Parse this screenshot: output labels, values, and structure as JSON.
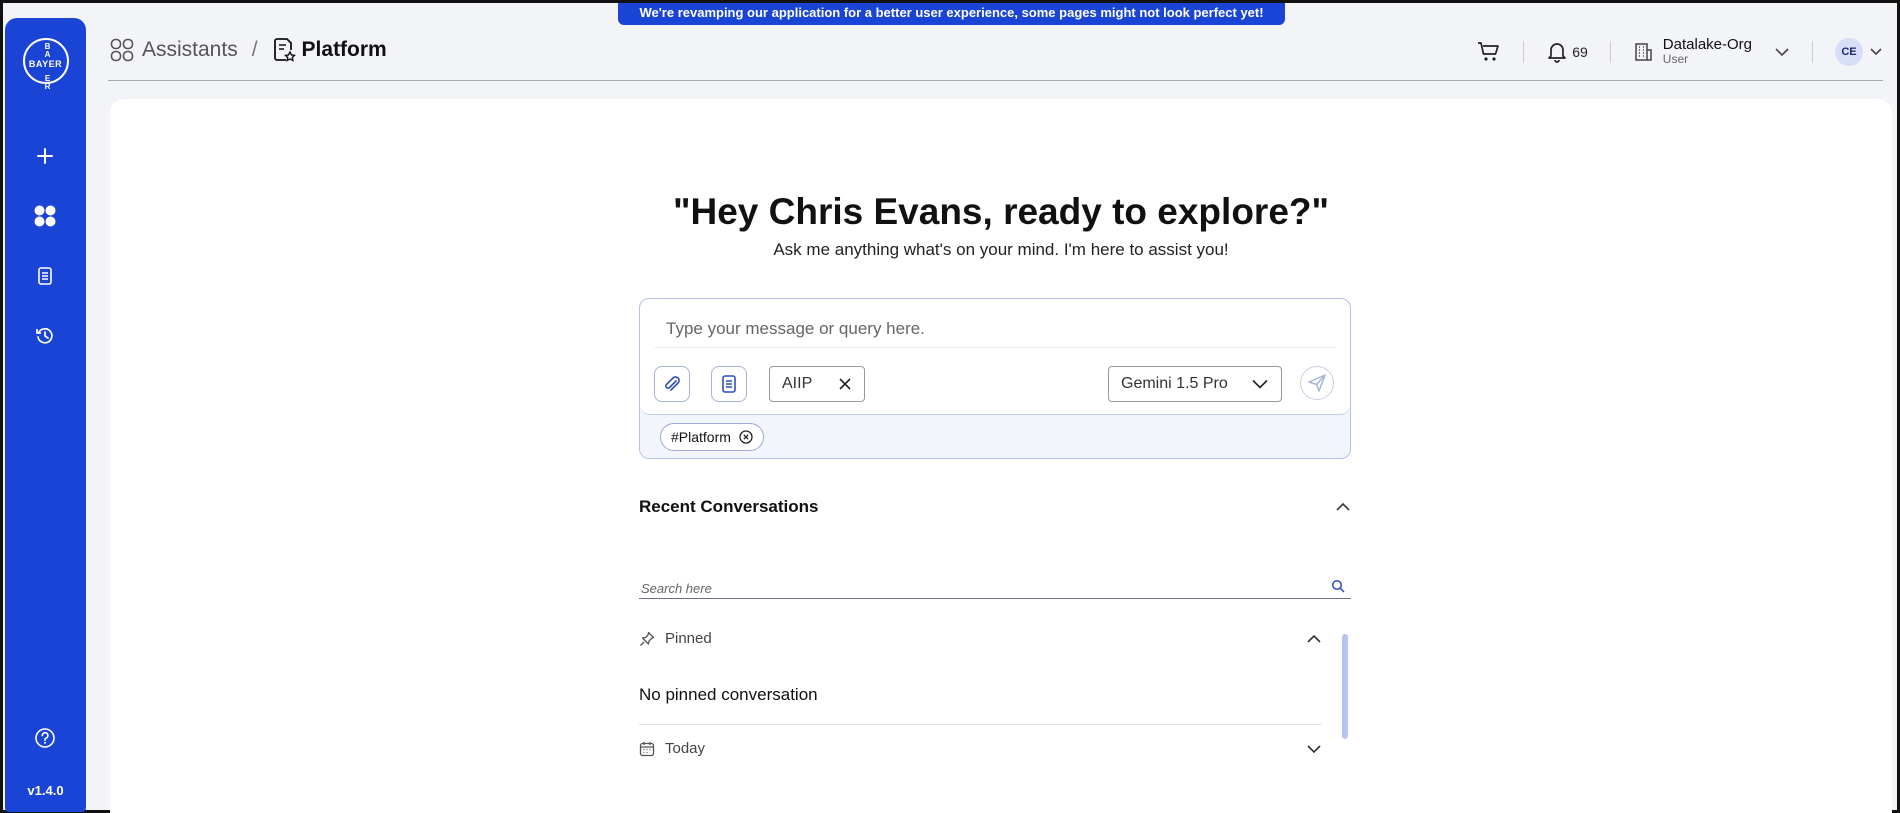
{
  "banner": {
    "text": "We're revamping our application for a better user experience, some pages might not look perfect yet!"
  },
  "sidebar": {
    "logo_text": "BAYER",
    "logo_vertical": [
      "B",
      "A",
      "Y",
      "E",
      "R"
    ],
    "items": [
      {
        "icon": "plus-icon"
      },
      {
        "icon": "assistants-grid-icon"
      },
      {
        "icon": "document-icon"
      },
      {
        "icon": "history-icon"
      }
    ],
    "help_icon": "help-icon",
    "version": "v1.4.0"
  },
  "header": {
    "breadcrumb": {
      "assistants": "Assistants",
      "separator": "/",
      "current": "Platform"
    },
    "notifications_count": "69",
    "org": {
      "name": "Datalake-Org",
      "role": "User"
    },
    "avatar_initials": "CE"
  },
  "main": {
    "greeting": "\"Hey Chris Evans, ready to explore?\"",
    "subtitle": "Ask me anything what's on your mind. I'm here to assist you!",
    "composer": {
      "placeholder": "Type your message or query here.",
      "chip_label": "AIIP",
      "model": "Gemini 1.5 Pro",
      "tag": "#Platform"
    },
    "recent": {
      "title": "Recent Conversations",
      "search_placeholder": "Search here",
      "pinned_label": "Pinned",
      "pinned_empty": "No pinned conversation",
      "today_label": "Today"
    }
  },
  "colors": {
    "brand": "#1a44d6",
    "accent_border": "#b7c1e8"
  }
}
